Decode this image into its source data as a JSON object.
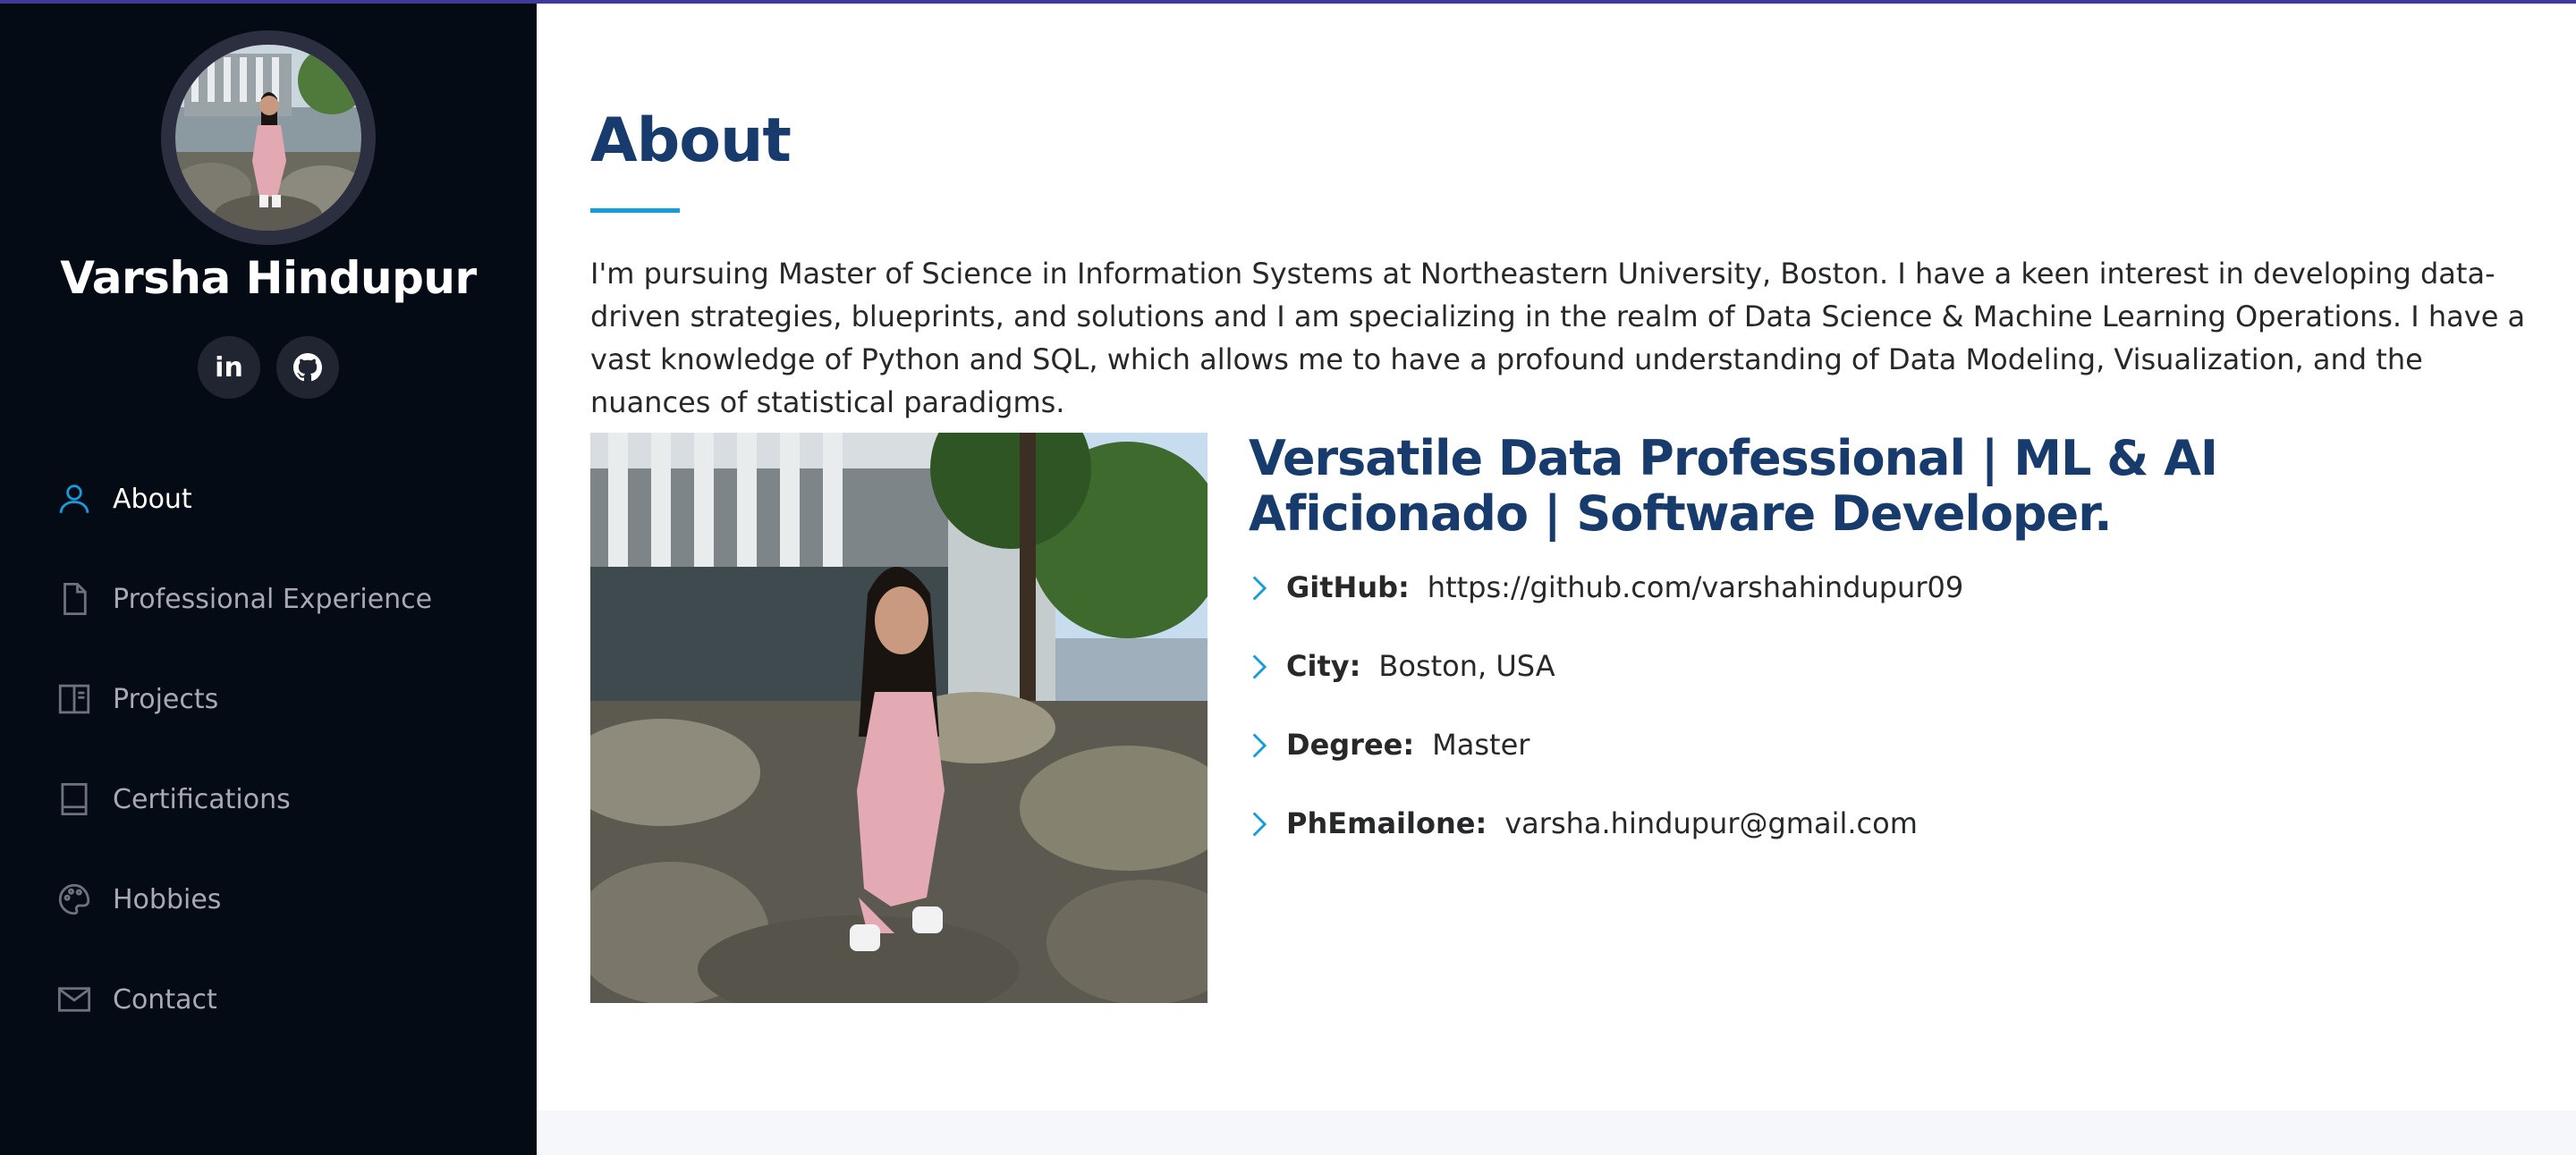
{
  "profile": {
    "name": "Varsha Hindupur"
  },
  "social": [
    {
      "icon": "linkedin-icon",
      "label": "in"
    },
    {
      "icon": "github-icon"
    }
  ],
  "nav": [
    {
      "label": "About",
      "icon": "person-icon",
      "active": true
    },
    {
      "label": "Professional Experience",
      "icon": "file-icon",
      "active": false
    },
    {
      "label": "Projects",
      "icon": "book-half-icon",
      "active": false
    },
    {
      "label": "Certifications",
      "icon": "journal-icon",
      "active": false
    },
    {
      "label": "Hobbies",
      "icon": "palette-icon",
      "active": false
    },
    {
      "label": "Contact",
      "icon": "envelope-icon",
      "active": false
    }
  ],
  "about": {
    "title": "About",
    "intro": "I'm pursuing Master of Science in Information Systems at Northeastern University, Boston. I have a keen interest in developing data-driven strategies, blueprints, and solutions and I am specializing in the realm of Data Science & Machine Learning Operations. I have a vast knowledge of Python and SQL, which allows me to have a profound understanding of Data Modeling, Visualization, and the nuances of statistical paradigms.",
    "headline": "Versatile Data Professional | ML & AI Aficionado | Software Developer.",
    "facts": [
      {
        "label": "GitHub:",
        "value": "https://github.com/varshahindupur09"
      },
      {
        "label": "City:",
        "value": "Boston, USA"
      },
      {
        "label": "Degree:",
        "value": "Master"
      },
      {
        "label": "PhEmailone:",
        "value": "varsha.hindupur@gmail.com"
      }
    ]
  },
  "colors": {
    "sidebar_bg": "#040b14",
    "accent": "#149ddd",
    "heading": "#173b6c",
    "top_border": "#3f3c99"
  }
}
